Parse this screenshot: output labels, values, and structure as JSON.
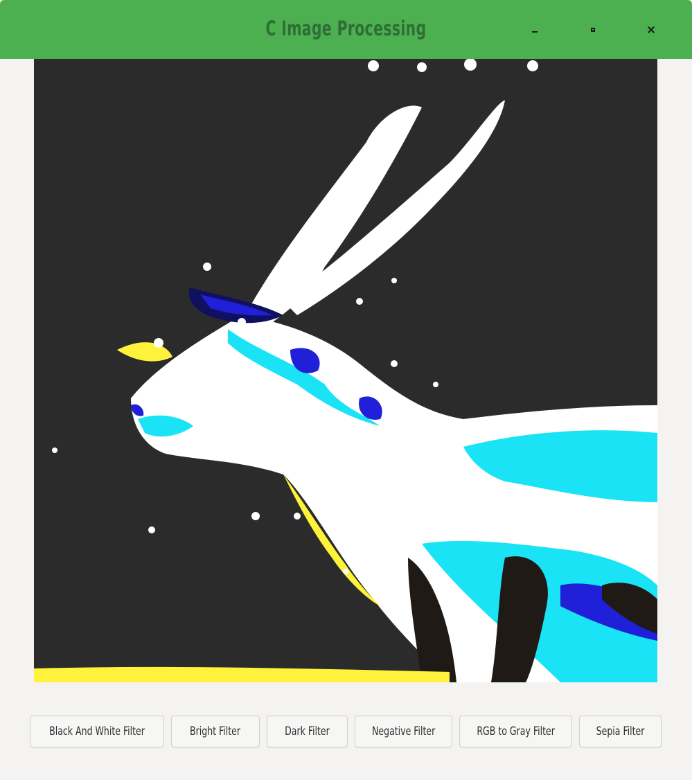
{
  "window": {
    "title": "C Image Processing",
    "controls": {
      "minimize": "minimize-icon",
      "maximize": "maximize-icon",
      "close": "close-icon"
    },
    "accent_color": "#4caf50"
  },
  "image": {
    "subject": "filtered-antelope-image",
    "colors": [
      "#2b2b2b",
      "#ffffff",
      "#19e3f5",
      "#2020d8",
      "#fff23a"
    ]
  },
  "filters": [
    {
      "label": "Black And White Filter"
    },
    {
      "label": "Bright Filter"
    },
    {
      "label": "Dark Filter"
    },
    {
      "label": "Negative Filter"
    },
    {
      "label": "RGB to Gray Filter"
    },
    {
      "label": "Sepia Filter"
    }
  ]
}
